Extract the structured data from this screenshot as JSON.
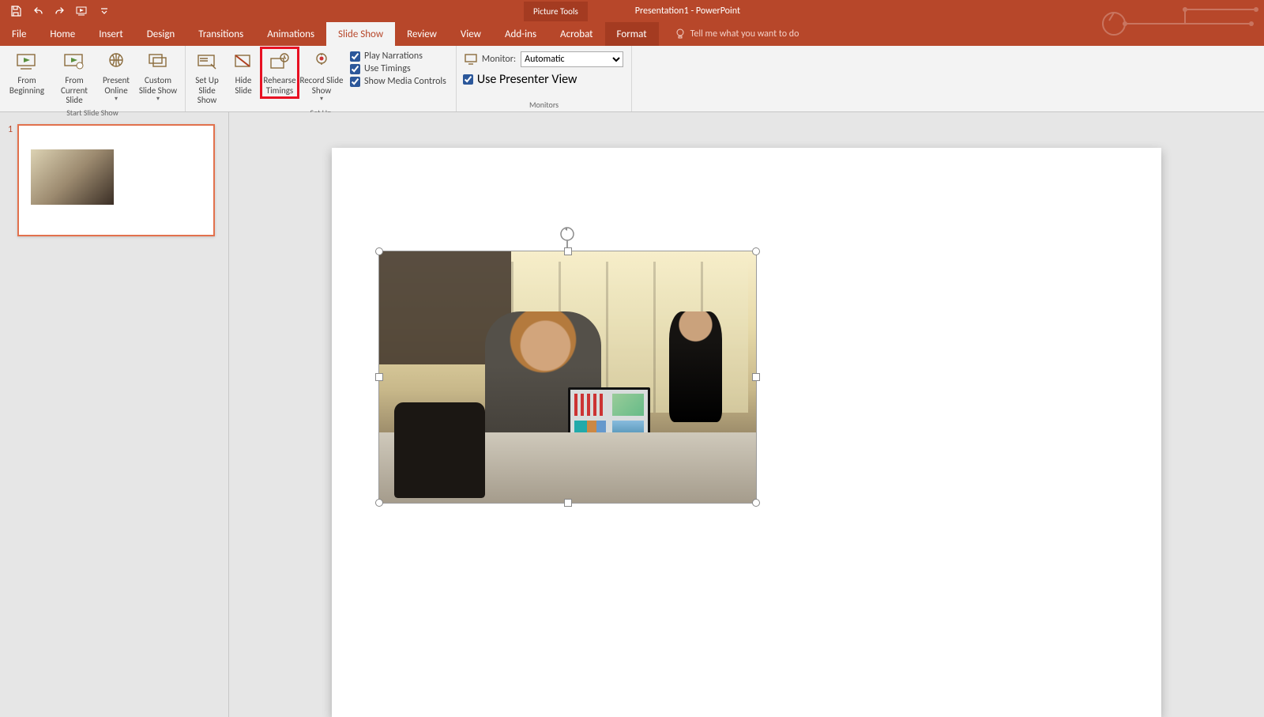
{
  "title_bar": {
    "context_tab": "Picture Tools",
    "doc_title": "Presentation1 - PowerPoint"
  },
  "tabs": {
    "file": "File",
    "home": "Home",
    "insert": "Insert",
    "design": "Design",
    "transitions": "Transitions",
    "animations": "Animations",
    "slide_show": "Slide Show",
    "review": "Review",
    "view": "View",
    "add_ins": "Add-ins",
    "acrobat": "Acrobat",
    "format": "Format",
    "tell_me": "Tell me what you want to do"
  },
  "ribbon": {
    "start_group": {
      "from_beginning": "From Beginning",
      "from_current": "From Current Slide",
      "present_online": "Present Online",
      "custom_show": "Custom Slide Show",
      "label": "Start Slide Show"
    },
    "setup_group": {
      "set_up": "Set Up Slide Show",
      "hide_slide": "Hide Slide",
      "rehearse": "Rehearse Timings",
      "record": "Record Slide Show",
      "play_narrations": "Play Narrations",
      "use_timings": "Use Timings",
      "show_media": "Show Media Controls",
      "label": "Set Up"
    },
    "monitors_group": {
      "monitor_label": "Monitor:",
      "monitor_value": "Automatic",
      "presenter_view": "Use Presenter View",
      "label": "Monitors"
    }
  },
  "thumbnails": {
    "slide1_number": "1"
  }
}
